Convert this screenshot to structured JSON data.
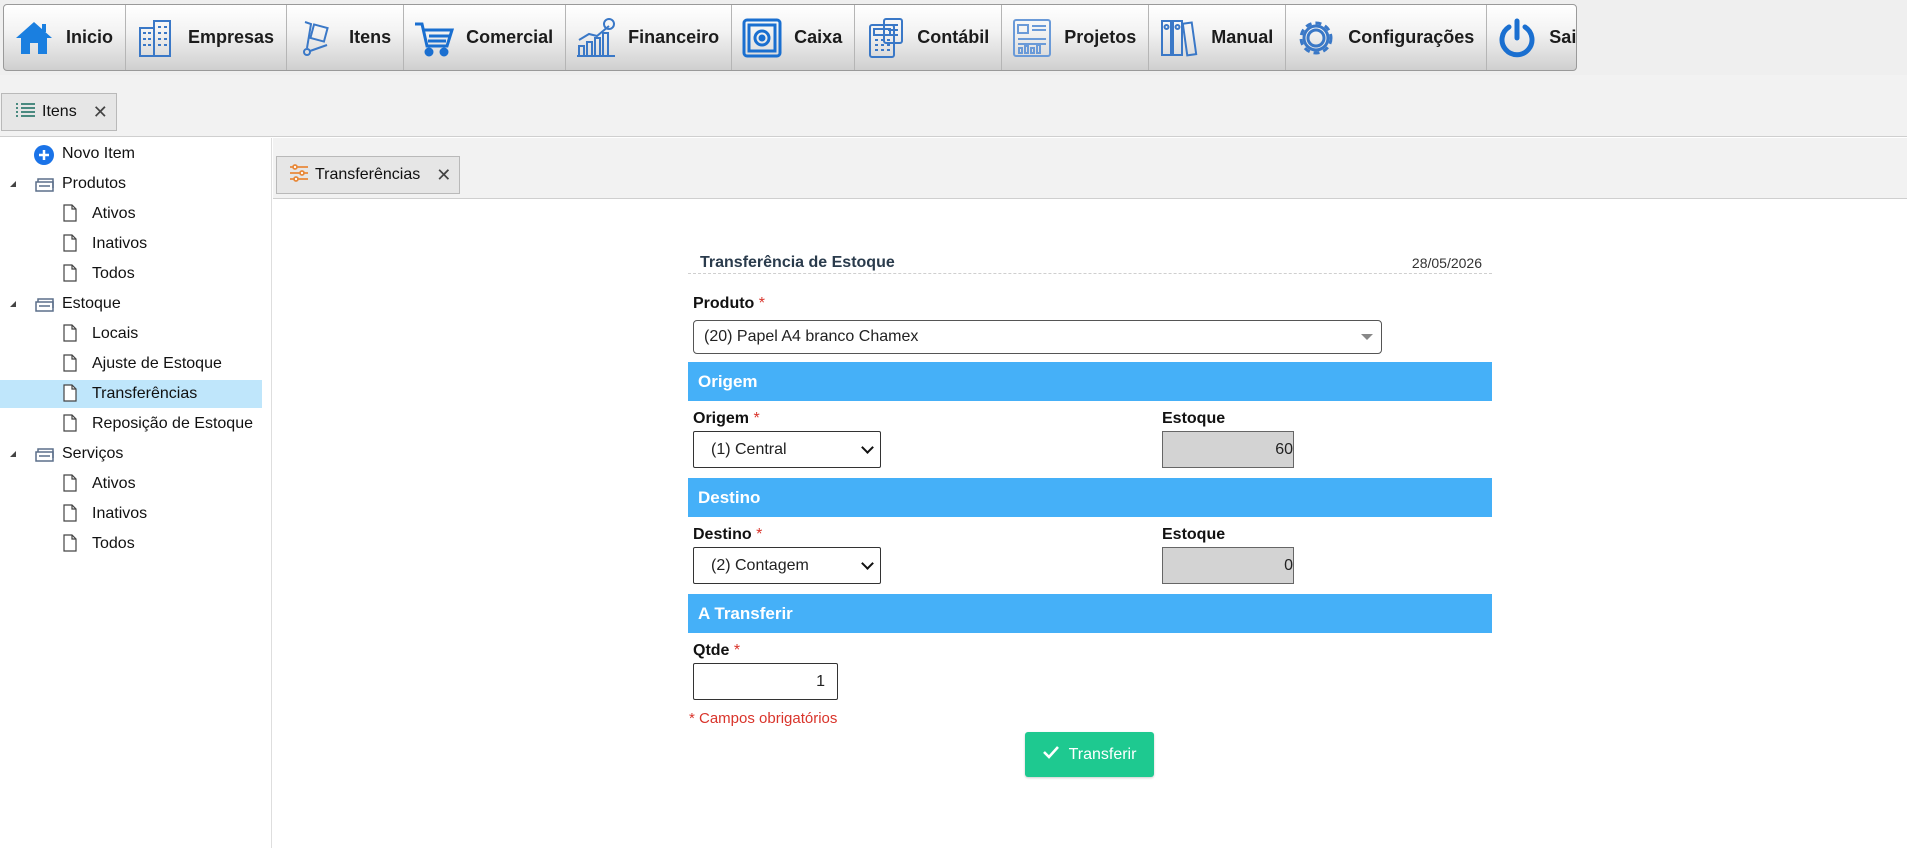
{
  "menu": {
    "items": [
      {
        "label": "Inicio",
        "icon": "home-icon"
      },
      {
        "label": "Empresas",
        "icon": "buildings-icon"
      },
      {
        "label": "Itens",
        "icon": "hand-truck-icon"
      },
      {
        "label": "Comercial",
        "icon": "shopping-cart-icon"
      },
      {
        "label": "Financeiro",
        "icon": "finance-chart-icon"
      },
      {
        "label": "Caixa",
        "icon": "safe-icon"
      },
      {
        "label": "Contábil",
        "icon": "calculator-icon"
      },
      {
        "label": "Projetos",
        "icon": "dashboard-icon"
      },
      {
        "label": "Manual",
        "icon": "binders-icon"
      },
      {
        "label": "Configurações",
        "icon": "gear-icon"
      },
      {
        "label": "Sair",
        "icon": "power-icon"
      }
    ]
  },
  "workspace_tab": {
    "label": "Itens"
  },
  "sidebar": {
    "novo_item": "Novo Item",
    "groups": [
      {
        "label": "Produtos",
        "children": [
          "Ativos",
          "Inativos",
          "Todos"
        ]
      },
      {
        "label": "Estoque",
        "children": [
          "Locais",
          "Ajuste de Estoque",
          "Transferências",
          "Reposição de Estoque"
        ]
      },
      {
        "label": "Serviços",
        "children": [
          "Ativos",
          "Inativos",
          "Todos"
        ]
      }
    ],
    "selected": "Transferências"
  },
  "content_tab": {
    "label": "Transferências"
  },
  "form": {
    "title": "Transferência de Estoque",
    "date": "28/05/2026",
    "produto_label": "Produto",
    "required_mark": "*",
    "produto_value": "(20) Papel A4 branco Chamex",
    "origem_section": "Origem",
    "origem_label": "Origem",
    "origem_value": "(1) Central",
    "estoque_label": "Estoque",
    "origem_estoque": "60",
    "destino_section": "Destino",
    "destino_label": "Destino",
    "destino_value": "(2) Contagem",
    "destino_estoque": "0",
    "transferir_section": "A Transferir",
    "qtde_label": "Qtde",
    "qtde_value": "1",
    "required_note": "* Campos obrigatórios",
    "submit_label": "Transferir"
  },
  "colors": {
    "section_bar": "#45b0f8",
    "submit_button": "#1ec990",
    "selected_row": "#bfe6fb",
    "required": "#d9342b"
  }
}
